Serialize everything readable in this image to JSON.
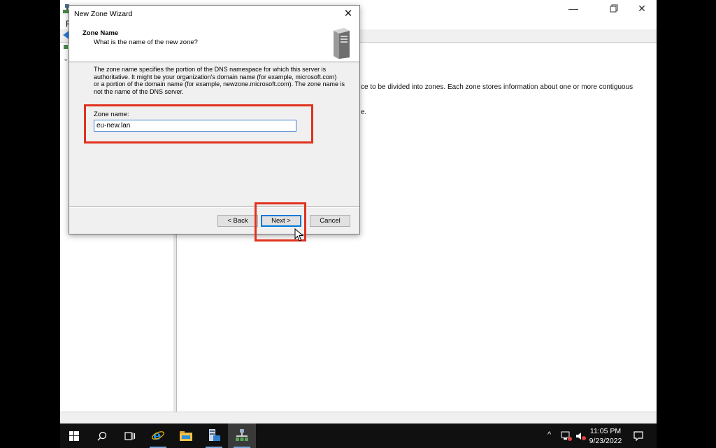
{
  "main_window": {
    "title_fragment": "",
    "menu_first_letter": "F",
    "content_lines": [
      "ce to be divided into zones. Each zone stores information about one or more contiguous",
      "e."
    ]
  },
  "wizard": {
    "title": "New Zone Wizard",
    "heading": "Zone Name",
    "subheading": "What is the name of the new zone?",
    "description_lines": [
      "The zone name specifies the portion of the DNS namespace for which this server is",
      "authoritative. It might be your organization's domain name (for example,  microsoft.com)",
      "or a portion of the domain name (for example, newzone.microsoft.com). The zone name is",
      "not the name of the DNS server."
    ],
    "zone_name_label": "Zone name:",
    "zone_name_value": "eu-new.lan",
    "buttons": {
      "back": "< Back",
      "next": "Next >",
      "cancel": "Cancel"
    }
  },
  "taskbar": {
    "time": "11:05 PM",
    "date": "9/23/2022",
    "icons": [
      "windows-start-icon",
      "search-icon",
      "task-view-icon",
      "internet-explorer-icon",
      "file-explorer-icon",
      "server-manager-icon",
      "dns-manager-icon"
    ]
  },
  "colors": {
    "highlight": "#e0321e",
    "accent": "#0078d7",
    "taskbar": "#101010"
  }
}
